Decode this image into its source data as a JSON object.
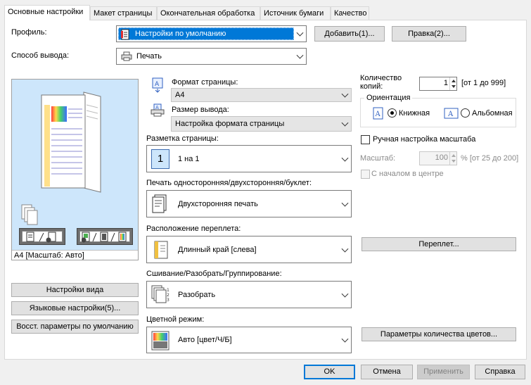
{
  "tabs": [
    {
      "label": "Основные настройки"
    },
    {
      "label": "Макет страницы"
    },
    {
      "label": "Окончательная обработка"
    },
    {
      "label": "Источник бумаги"
    },
    {
      "label": "Качество"
    }
  ],
  "profile": {
    "label": "Профиль:",
    "value": "Настройки по умолчанию",
    "add_button": "Добавить(1)...",
    "edit_button": "Правка(2)..."
  },
  "output_method": {
    "label": "Способ вывода:",
    "value": "Печать"
  },
  "preview": {
    "caption": "A4 [Масштаб: Авто]"
  },
  "page_size": {
    "label": "Формат страницы:",
    "value": "A4"
  },
  "output_size": {
    "label": "Размер вывода:",
    "value": "Настройка формата страницы"
  },
  "page_layout": {
    "label": "Разметка страницы:",
    "value": "1 на 1",
    "icon_number": "1"
  },
  "duplex": {
    "label": "Печать односторонняя/двухсторонняя/буклет:",
    "value": "Двухсторонняя печать"
  },
  "binding": {
    "label": "Расположение переплета:",
    "value": "Длинный край [слева]"
  },
  "collate": {
    "label": "Сшивание/Разобрать/Группирование:",
    "value": "Разобрать"
  },
  "color_mode": {
    "label": "Цветной режим:",
    "value": "Авто [цвет/Ч/Б]"
  },
  "copies": {
    "label_line1": "Количество",
    "label_line2": "копий:",
    "value": "1",
    "range": "[от 1 до 999]"
  },
  "orientation": {
    "label": "Ориентация",
    "portrait": "Книжная",
    "landscape": "Альбомная",
    "selected": "portrait"
  },
  "manual_scale": {
    "label": "Ручная настройка масштаба",
    "checked": false
  },
  "scale": {
    "label": "Масштаб:",
    "value": "100",
    "range": "% [от 25 до 200]"
  },
  "center_start": {
    "label": "С началом в центре"
  },
  "left_buttons": {
    "view_settings": "Настройки вида",
    "language_settings": "Языковые настройки(5)...",
    "restore_defaults": "Восст. параметры по умолчанию"
  },
  "binding_button": "Переплет...",
  "color_count_button": "Параметры количества цветов...",
  "footer": {
    "ok": "OK",
    "cancel": "Отмена",
    "apply": "Применить",
    "help": "Справка"
  },
  "colors": {
    "selection": "#0078d7",
    "preview_bg": "#cde6fb",
    "button": "#e1e1e1"
  }
}
